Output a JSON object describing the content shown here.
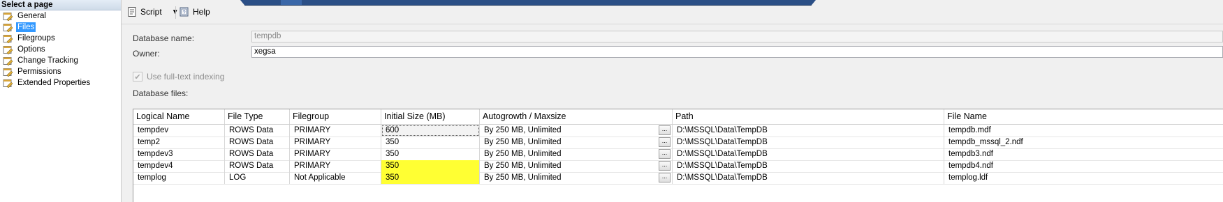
{
  "nav": {
    "header": "Select a page",
    "items": [
      {
        "label": "General",
        "selected": false
      },
      {
        "label": "Files",
        "selected": true
      },
      {
        "label": "Filegroups",
        "selected": false
      },
      {
        "label": "Options",
        "selected": false
      },
      {
        "label": "Change Tracking",
        "selected": false
      },
      {
        "label": "Permissions",
        "selected": false
      },
      {
        "label": "Extended Properties",
        "selected": false
      }
    ]
  },
  "toolbar": {
    "script_label": "Script",
    "help_label": "Help"
  },
  "form": {
    "db_name_label": "Database name:",
    "db_name_value": "tempdb",
    "owner_label": "Owner:",
    "owner_value": "xegsa",
    "fulltext_label": "Use full-text indexing",
    "fulltext_checked": true,
    "db_files_label": "Database files:"
  },
  "grid": {
    "columns": [
      "Logical Name",
      "File Type",
      "Filegroup",
      "Initial Size (MB)",
      "Autogrowth / Maxsize",
      "Path",
      "File Name"
    ],
    "rows": [
      {
        "logical": "tempdev",
        "type": "ROWS Data",
        "filegroup": "PRIMARY",
        "size": "600",
        "autogrowth": "By 250 MB, Unlimited",
        "path": "D:\\MSSQL\\Data\\TempDB",
        "file": "tempdb.mdf"
      },
      {
        "logical": "temp2",
        "type": "ROWS Data",
        "filegroup": "PRIMARY",
        "size": "350",
        "autogrowth": "By 250 MB, Unlimited",
        "path": "D:\\MSSQL\\Data\\TempDB",
        "file": "tempdb_mssql_2.ndf"
      },
      {
        "logical": "tempdev3",
        "type": "ROWS Data",
        "filegroup": "PRIMARY",
        "size": "350",
        "autogrowth": "By 250 MB, Unlimited",
        "path": "D:\\MSSQL\\Data\\TempDB",
        "file": "tempdb3.ndf"
      },
      {
        "logical": "tempdev4",
        "type": "ROWS Data",
        "filegroup": "PRIMARY",
        "size": "350",
        "autogrowth": "By 250 MB, Unlimited",
        "path": "D:\\MSSQL\\Data\\TempDB",
        "file": "tempdb4.ndf"
      },
      {
        "logical": "templog",
        "type": "LOG",
        "filegroup": "Not Applicable",
        "size": "350",
        "autogrowth": "By 250 MB, Unlimited",
        "path": "D:\\MSSQL\\Data\\TempDB",
        "file": "templog.ldf"
      }
    ],
    "ellipsis_label": "...",
    "highlight_color": "#ffff33"
  },
  "colors": {
    "selection": "#3399ff",
    "tab_strip": "#2b4f86"
  }
}
